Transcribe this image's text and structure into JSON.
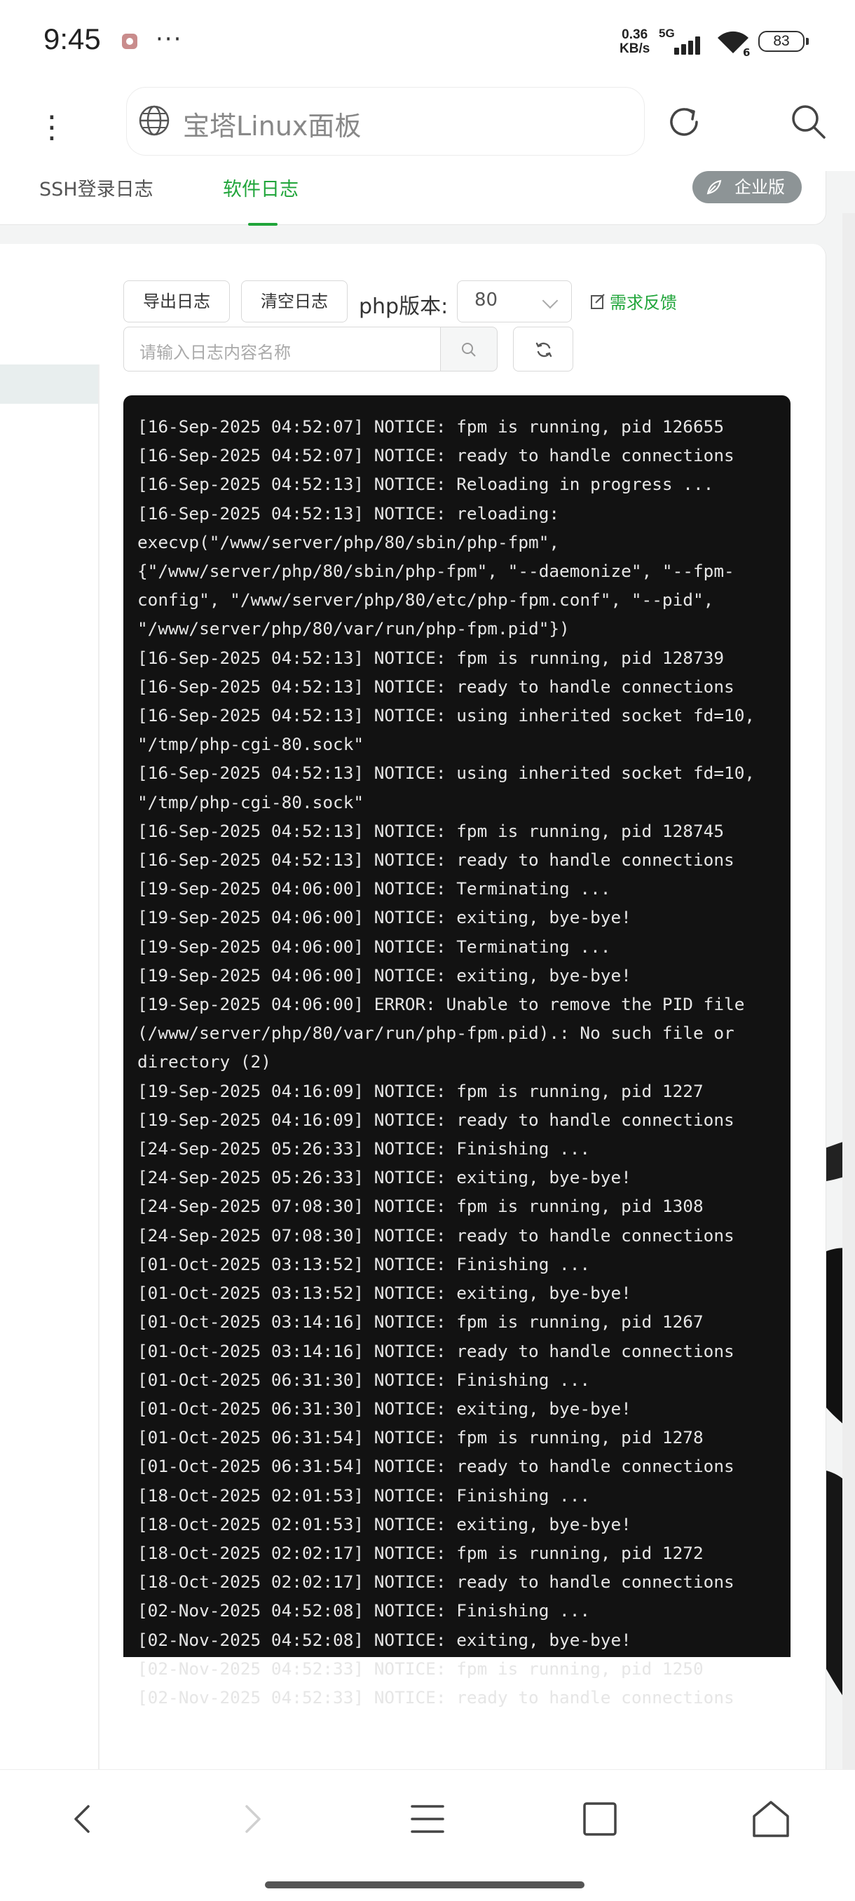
{
  "status_bar": {
    "time": "9:45",
    "net_speed_value": "0.36",
    "net_speed_unit": "KB/s",
    "network": "5G",
    "wifi_sub": "6",
    "battery": "83"
  },
  "browser": {
    "address_text": "宝塔Linux面板",
    "icons": [
      "more-vertical-icon",
      "globe-icon",
      "reload-icon",
      "search-icon"
    ]
  },
  "tabs": [
    {
      "label": "SSH登录日志",
      "active": false
    },
    {
      "label": "软件日志",
      "active": true
    }
  ],
  "enterprise_badge": "企业版",
  "toolbar": {
    "export_label": "导出日志",
    "clear_label": "清空日志",
    "php_version_label": "php版本:",
    "php_version_value": "80",
    "feedback_label": "需求反馈",
    "search_placeholder": "请输入日志内容名称"
  },
  "log_lines": [
    "[16-Sep-2025 04:52:07] NOTICE: fpm is running, pid 126655",
    "[16-Sep-2025 04:52:07] NOTICE: ready to handle connections",
    "[16-Sep-2025 04:52:13] NOTICE: Reloading in progress ...",
    "[16-Sep-2025 04:52:13] NOTICE: reloading: execvp(\"/www/server/php/80/sbin/php-fpm\", {\"/www/server/php/80/sbin/php-fpm\", \"--daemonize\", \"--fpm-config\", \"/www/server/php/80/etc/php-fpm.conf\", \"--pid\", \"/www/server/php/80/var/run/php-fpm.pid\"})",
    "[16-Sep-2025 04:52:13] NOTICE: fpm is running, pid 128739",
    "[16-Sep-2025 04:52:13] NOTICE: ready to handle connections",
    "[16-Sep-2025 04:52:13] NOTICE: using inherited socket fd=10, \"/tmp/php-cgi-80.sock\"",
    "[16-Sep-2025 04:52:13] NOTICE: using inherited socket fd=10, \"/tmp/php-cgi-80.sock\"",
    "[16-Sep-2025 04:52:13] NOTICE: fpm is running, pid 128745",
    "[16-Sep-2025 04:52:13] NOTICE: ready to handle connections",
    "[19-Sep-2025 04:06:00] NOTICE: Terminating ...",
    "[19-Sep-2025 04:06:00] NOTICE: exiting, bye-bye!",
    "[19-Sep-2025 04:06:00] NOTICE: Terminating ...",
    "[19-Sep-2025 04:06:00] NOTICE: exiting, bye-bye!",
    "[19-Sep-2025 04:06:00] ERROR: Unable to remove the PID file (/www/server/php/80/var/run/php-fpm.pid).: No such file or directory (2)",
    "[19-Sep-2025 04:16:09] NOTICE: fpm is running, pid 1227",
    "[19-Sep-2025 04:16:09] NOTICE: ready to handle connections",
    "[24-Sep-2025 05:26:33] NOTICE: Finishing ...",
    "[24-Sep-2025 05:26:33] NOTICE: exiting, bye-bye!",
    "[24-Sep-2025 07:08:30] NOTICE: fpm is running, pid 1308",
    "[24-Sep-2025 07:08:30] NOTICE: ready to handle connections",
    "[01-Oct-2025 03:13:52] NOTICE: Finishing ...",
    "[01-Oct-2025 03:13:52] NOTICE: exiting, bye-bye!",
    "[01-Oct-2025 03:14:16] NOTICE: fpm is running, pid 1267",
    "[01-Oct-2025 03:14:16] NOTICE: ready to handle connections",
    "[01-Oct-2025 06:31:30] NOTICE: Finishing ...",
    "[01-Oct-2025 06:31:30] NOTICE: exiting, bye-bye!",
    "[01-Oct-2025 06:31:54] NOTICE: fpm is running, pid 1278",
    "[01-Oct-2025 06:31:54] NOTICE: ready to handle connections",
    "[18-Oct-2025 02:01:53] NOTICE: Finishing ...",
    "[18-Oct-2025 02:01:53] NOTICE: exiting, bye-bye!",
    "[18-Oct-2025 02:02:17] NOTICE: fpm is running, pid 1272",
    "[18-Oct-2025 02:02:17] NOTICE: ready to handle connections",
    "[02-Nov-2025 04:52:08] NOTICE: Finishing ...",
    "[02-Nov-2025 04:52:08] NOTICE: exiting, bye-bye!",
    "[02-Nov-2025 04:52:33] NOTICE: fpm is running, pid 1250",
    "[02-Nov-2025 04:52:33] NOTICE: ready to handle connections"
  ],
  "bottom_nav": [
    "back-icon",
    "forward-icon",
    "menu-icon",
    "tabs-icon",
    "home-icon"
  ],
  "colors": {
    "accent": "#20a53a",
    "log_bg": "#121212",
    "log_text": "#e6e6e6",
    "badge_bg": "#8d9496"
  }
}
